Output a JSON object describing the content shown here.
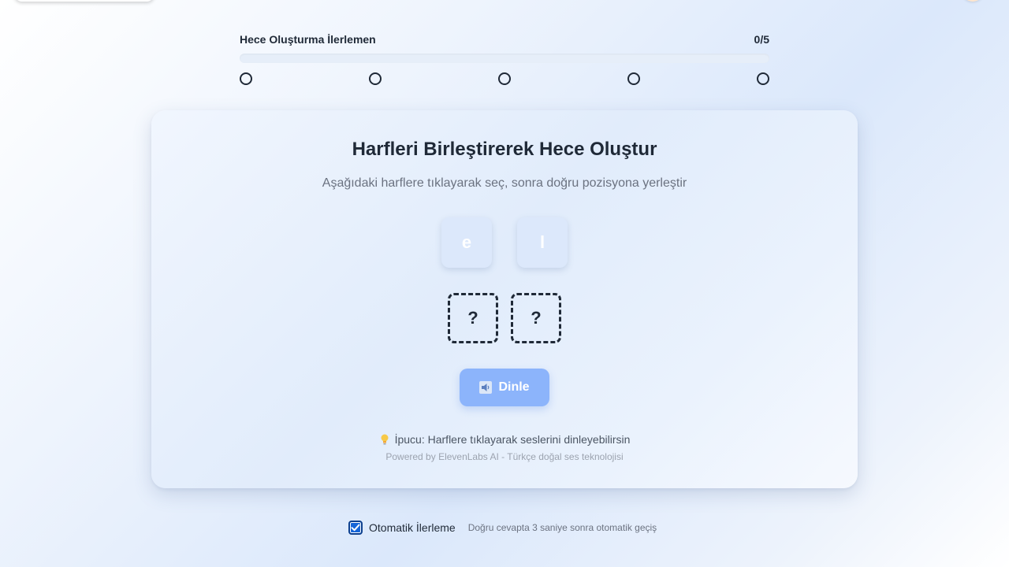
{
  "progress": {
    "title": "Hece Oluşturma İlerlemen",
    "count": "0/5",
    "completed": 0,
    "total": 5,
    "fill_fraction": 0.0,
    "steps": [
      {
        "state": "empty"
      },
      {
        "state": "empty"
      },
      {
        "state": "empty"
      },
      {
        "state": "empty"
      },
      {
        "state": "empty"
      }
    ]
  },
  "card": {
    "title": "Harfleri Birleştirerek Hece Oluştur",
    "subtitle": "Aşağıdaki harflere tıklayarak seç, sonra doğru pozisyona yerleştir",
    "letters": [
      "e",
      "l"
    ],
    "slots": [
      "?",
      "?"
    ],
    "listen_button": {
      "icon": "speaker-icon",
      "label": "Dinle"
    },
    "hint": {
      "icon": "lightbulb-icon",
      "text": "İpucu: Harflere tıklayarak seslerini dinleyebilirsin"
    },
    "powered_by": "Powered by ElevenLabs AI - Türkçe doğal ses teknolojisi"
  },
  "auto_advance": {
    "checked": true,
    "label": "Otomatik İlerleme",
    "description": "Doğru cevapta 3 saniye sonra otomatik geçiş"
  },
  "colors": {
    "accent": "#3b82f6",
    "button": "#8cb4fb",
    "checkbox": "#1565d8",
    "text_dark": "#1f2937",
    "text_muted": "#6b7280"
  }
}
